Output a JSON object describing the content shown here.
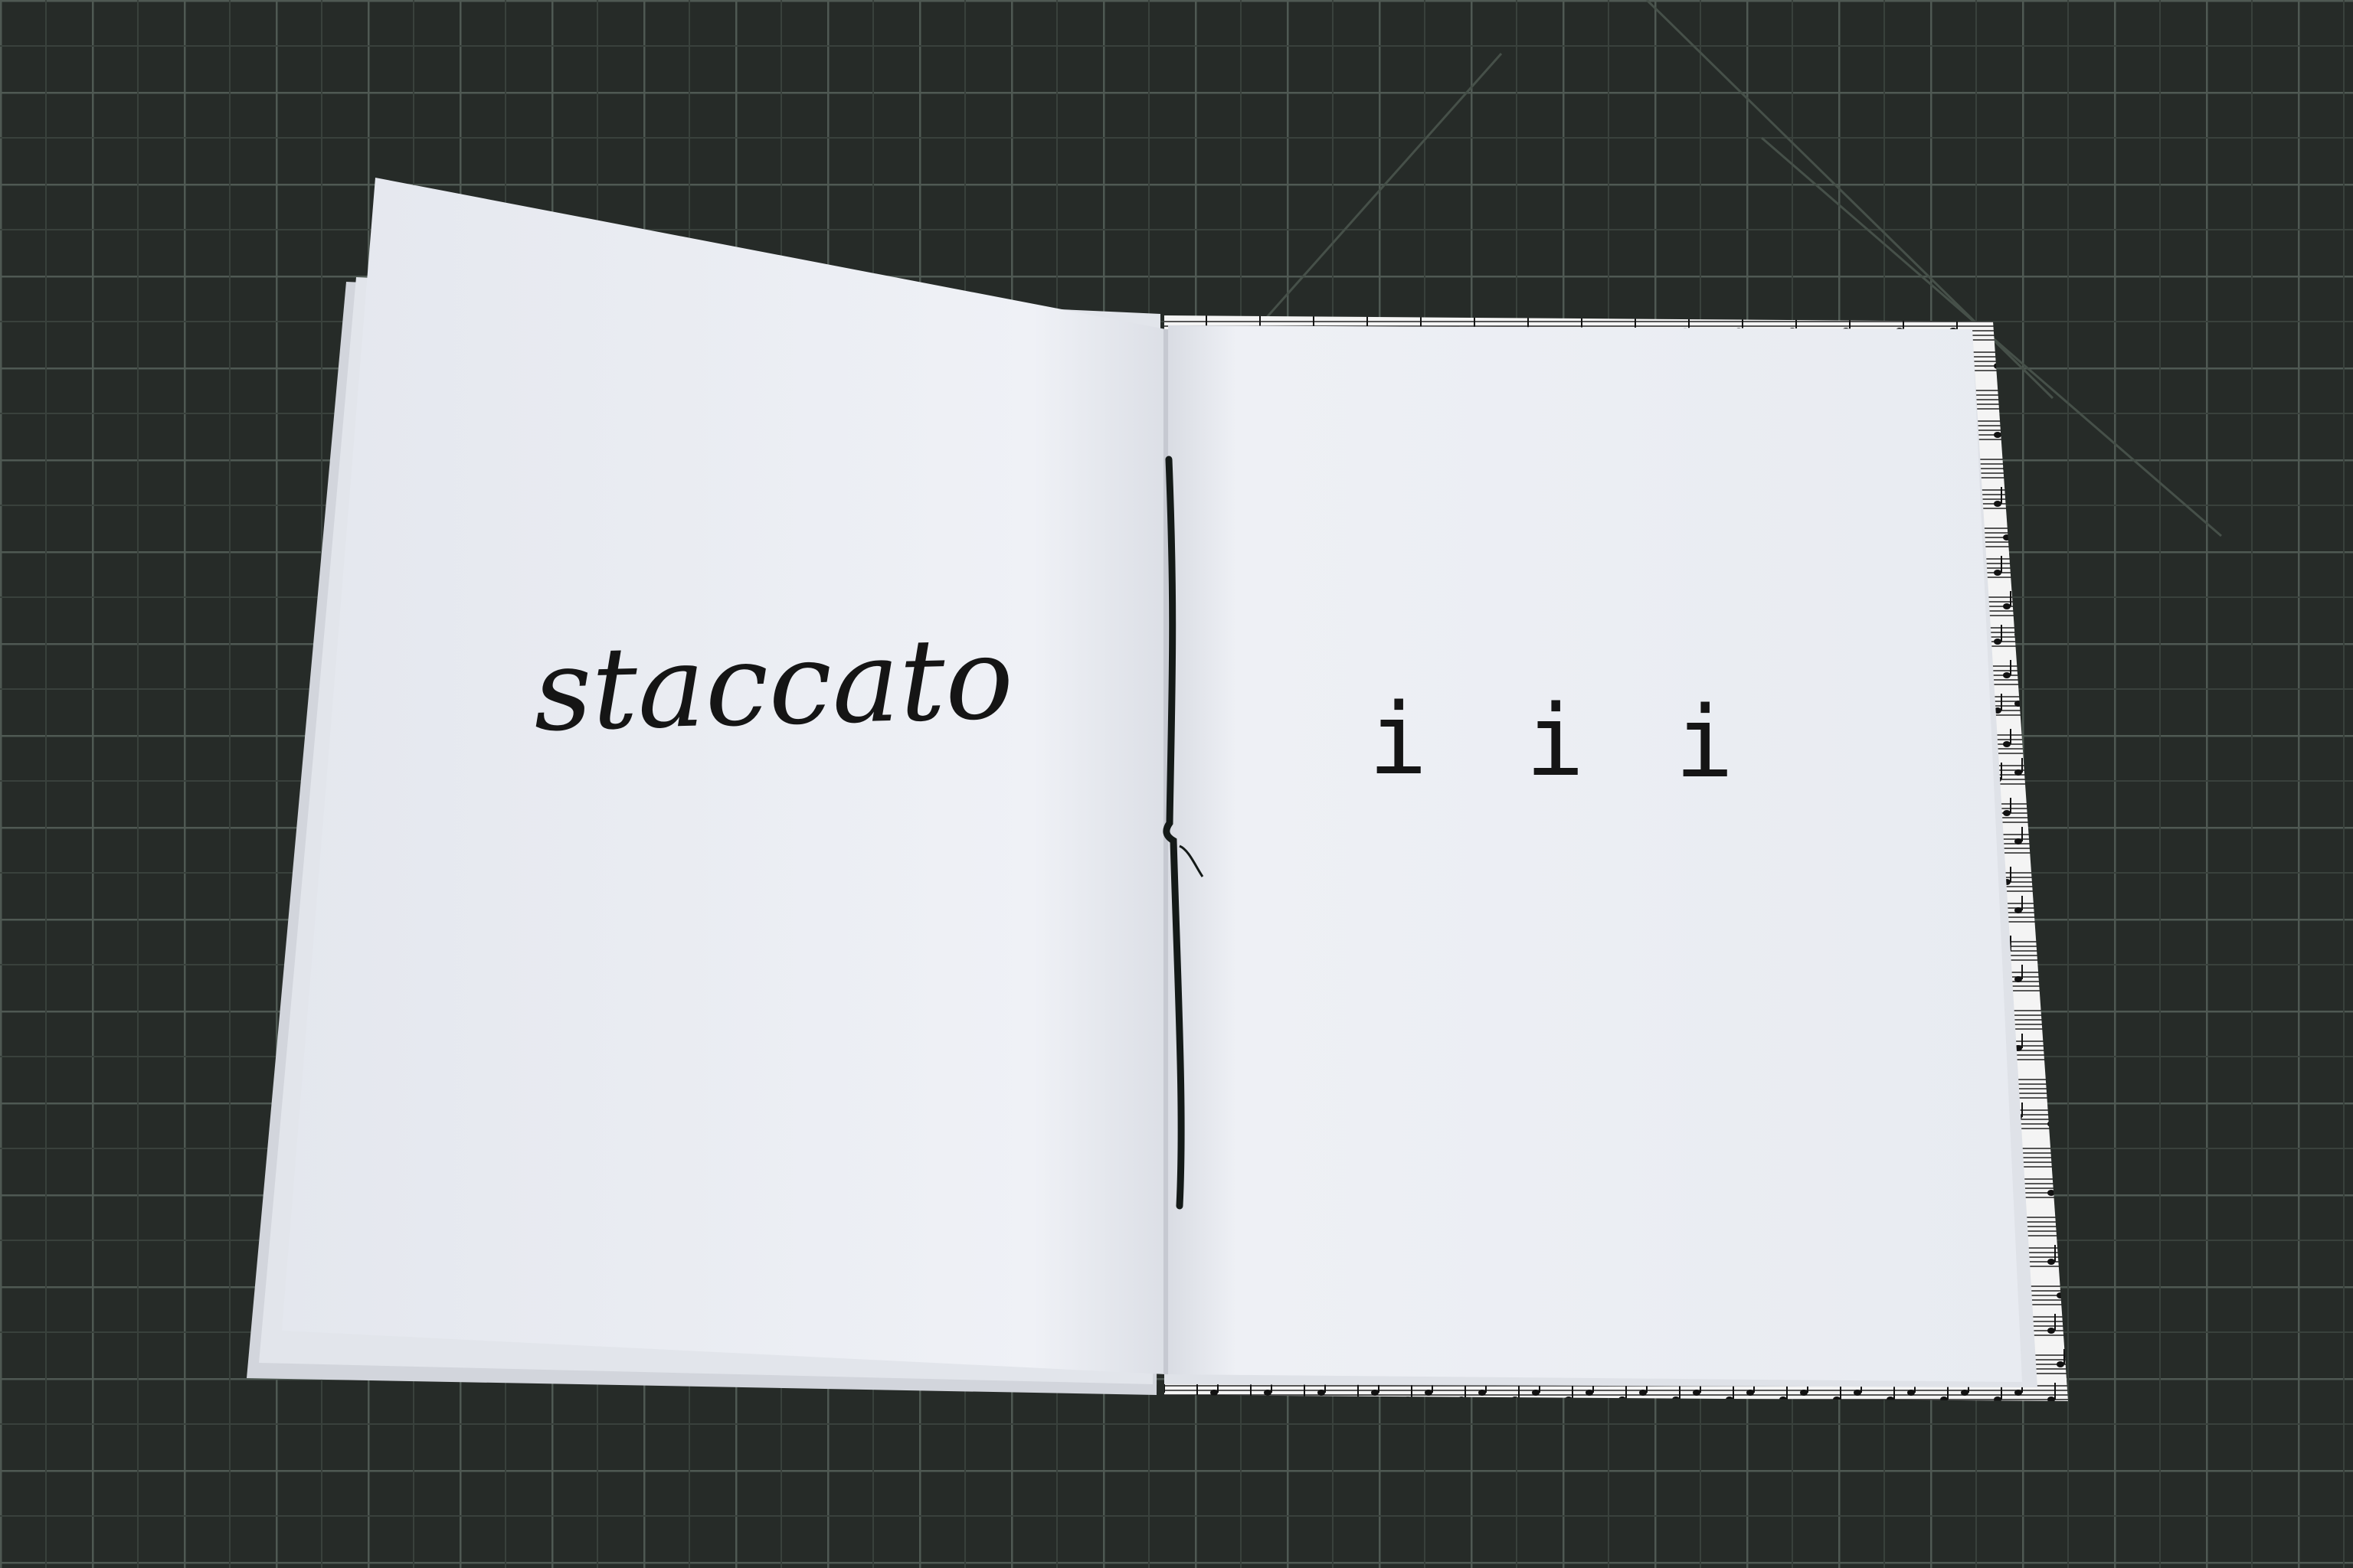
{
  "left_page": {
    "word": "staccato"
  },
  "right_page": {
    "marks": [
      "i",
      "i",
      "i"
    ]
  },
  "colors": {
    "mat": "#262b28",
    "grid_line": "#56605a",
    "page": "#eef0f5",
    "ink": "#151515",
    "thread": "#141a18"
  }
}
